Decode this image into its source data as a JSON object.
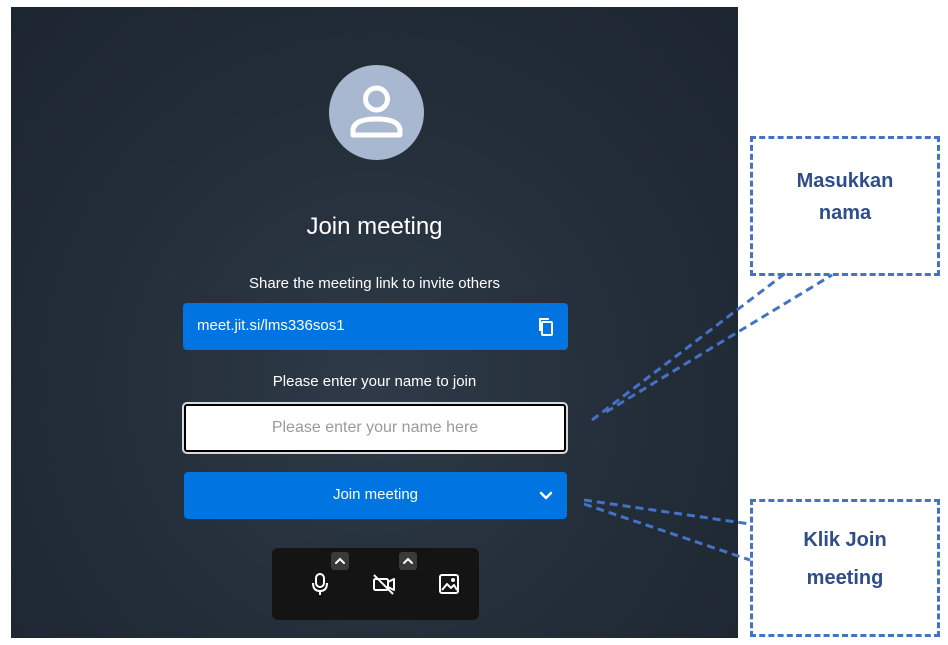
{
  "prejoin": {
    "avatar_icon": "user-icon",
    "title": "Join meeting",
    "share_label": "Share the meeting link to invite others",
    "meeting_link": "meet.jit.si/lms336sos1",
    "copy_icon": "copy-icon",
    "name_label": "Please enter your name to join",
    "name_placeholder": "Please enter your name here",
    "name_value": "",
    "join_button": "Join meeting",
    "join_options_icon": "chevron-down-icon"
  },
  "toolbar": {
    "items": [
      {
        "icon": "microphone-icon"
      },
      {
        "icon": "camera-off-icon"
      },
      {
        "icon": "background-image-icon"
      }
    ],
    "caret_icon": "caret-up-icon"
  },
  "annotations": [
    {
      "line1": "Masukkan",
      "line2": "nama"
    },
    {
      "line1": "Klik Join",
      "line2": "meeting"
    }
  ],
  "colors": {
    "accent": "#0074e0",
    "background": "#232d38",
    "annotation": "#4472c4",
    "annotation_text": "#2f4d8a"
  }
}
